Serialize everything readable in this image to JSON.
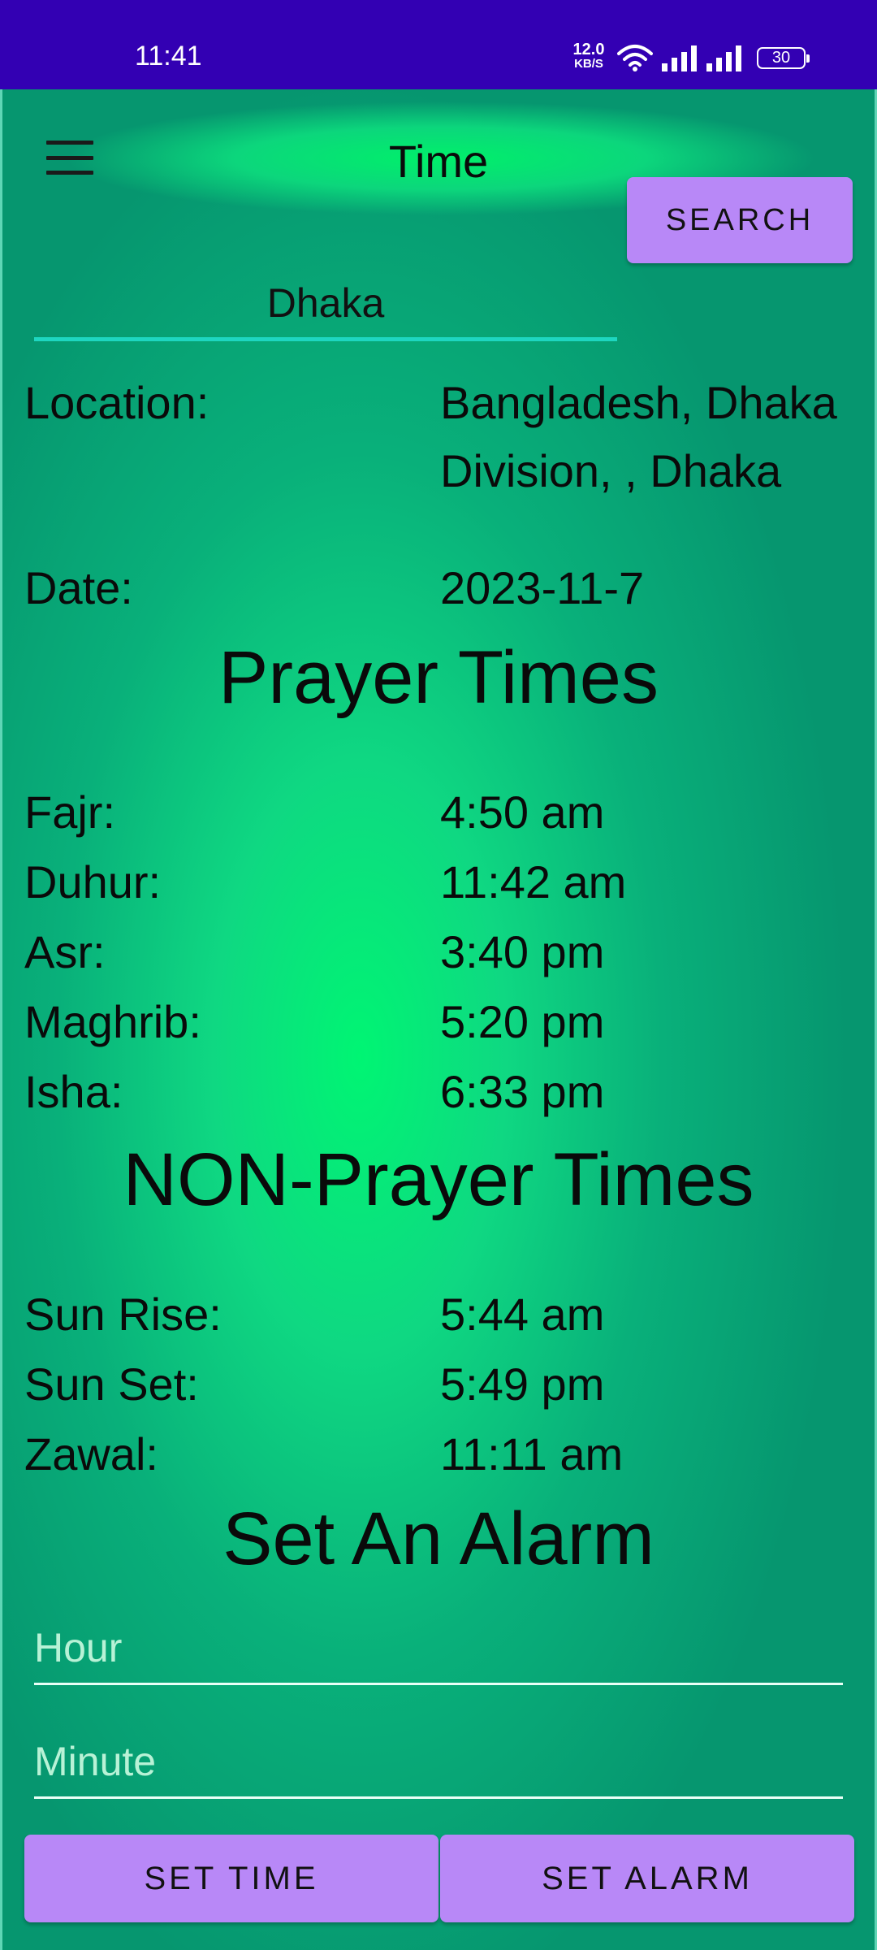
{
  "status_bar": {
    "time": "11:41",
    "net_speed_value": "12.0",
    "net_speed_unit": "KB/S",
    "battery": "30",
    "icons": [
      "wifi-icon",
      "signal-icon",
      "signal-icon",
      "battery-icon"
    ]
  },
  "app_bar": {
    "title": "Time",
    "menu_icon": "hamburger-menu-icon"
  },
  "search": {
    "value": "Dhaka",
    "button_label": "SEARCH"
  },
  "info": {
    "location_label": "Location:",
    "location_value": "Bangladesh, Dhaka Division, , Dhaka",
    "date_label": "Date:",
    "date_value": "2023-11-7"
  },
  "prayer": {
    "title": "Prayer Times",
    "items": [
      {
        "label": "Fajr:",
        "value": "4:50 am"
      },
      {
        "label": "Duhur:",
        "value": "11:42 am"
      },
      {
        "label": "Asr:",
        "value": "3:40 pm"
      },
      {
        "label": "Maghrib:",
        "value": "5:20 pm"
      },
      {
        "label": "Isha:",
        "value": "6:33 pm"
      }
    ]
  },
  "non_prayer": {
    "title": "NON-Prayer Times",
    "items": [
      {
        "label": "Sun Rise:",
        "value": "5:44 am"
      },
      {
        "label": "Sun Set:",
        "value": "5:49 pm"
      },
      {
        "label": "Zawal:",
        "value": "11:11 am"
      }
    ]
  },
  "alarm": {
    "title": "Set An Alarm",
    "hour_placeholder": "Hour",
    "minute_placeholder": "Minute",
    "set_time_label": "SET TIME",
    "set_alarm_label": "SET ALARM"
  },
  "colors": {
    "status_bar": "#3300b3",
    "background": "#06966f",
    "accent_glow": "#00f573",
    "button": "#b888f7",
    "input_underline": "#1ed6c0"
  }
}
